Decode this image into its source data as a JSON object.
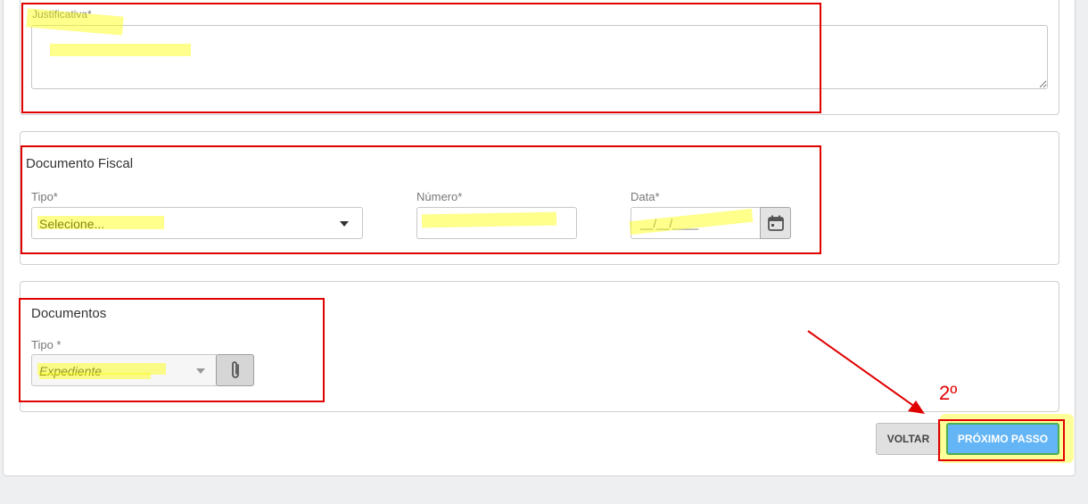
{
  "justification": {
    "label": "Justificativa*",
    "value": ""
  },
  "fiscal": {
    "title": "Documento Fiscal",
    "tipo_label": "Tipo*",
    "tipo_value": "Selecione...",
    "numero_label": "Número*",
    "numero_value": "",
    "data_label": "Data*",
    "data_placeholder": "__/__/____"
  },
  "documents": {
    "title": "Documentos",
    "tipo_label": "Tipo *",
    "tipo_value": "Expediente"
  },
  "actions": {
    "back_label": "VOLTAR",
    "next_label": "PRÓXIMO PASSO"
  },
  "annotation": {
    "step_text": "2º"
  },
  "icons": {
    "calendar": "calendar-icon",
    "attach": "paperclip-icon",
    "dropdown": "chevron-down-icon"
  },
  "colors": {
    "annotation_red": "#e00000",
    "highlight_yellow": "#ffff00",
    "next_button_bg": "#64b5f6",
    "back_button_bg": "#e0e0e0"
  }
}
